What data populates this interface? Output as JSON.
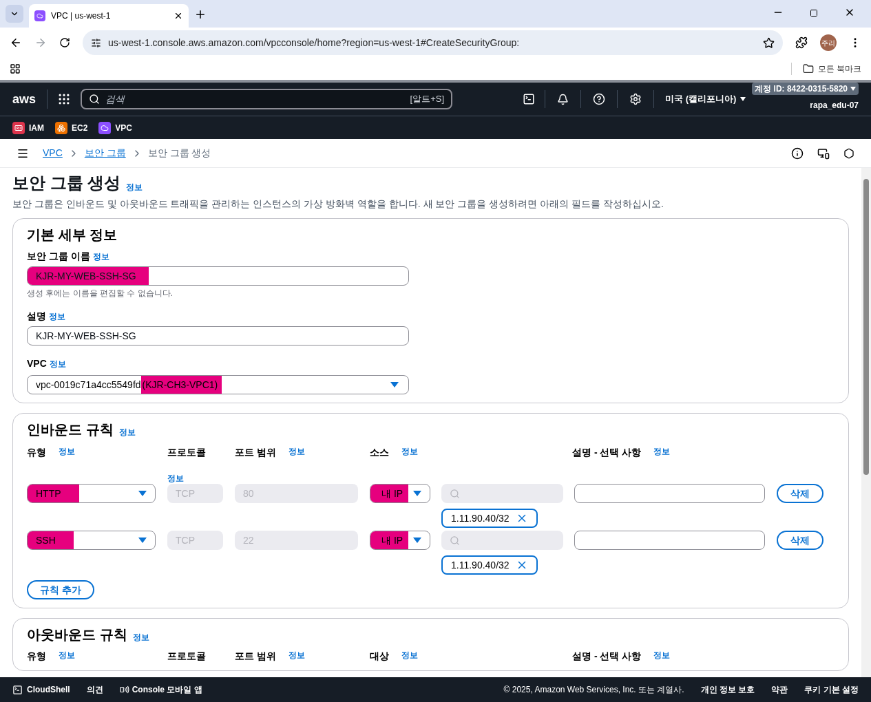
{
  "browser": {
    "tab_title": "VPC | us-west-1",
    "url": "us-west-1.console.aws.amazon.com/vpcconsole/home?region=us-west-1#CreateSecurityGroup:",
    "profile": "주리",
    "bookmarks_label": "모든 북마크"
  },
  "topnav": {
    "logo": "aws",
    "search_placeholder": "검색",
    "shortcut": "[알트+S]",
    "region": "미국 (캘리포니아)",
    "account": "계정 ID: 8422-0315-5820",
    "user": "rapa_edu-07"
  },
  "services": [
    {
      "label": "IAM",
      "color": "#dd344c"
    },
    {
      "label": "EC2",
      "color": "#ed7100"
    },
    {
      "label": "VPC",
      "color": "#8c4fff"
    }
  ],
  "breadcrumbs": [
    {
      "label": "VPC",
      "link": true
    },
    {
      "label": "보안 그룹",
      "link": true
    },
    {
      "label": "보안 그룹 생성",
      "link": false
    }
  ],
  "page": {
    "title": "보안 그룹 생성",
    "info": "정보",
    "description": "보안 그룹은 인바운드 및 아웃바운드 트래픽을 관리하는 인스턴스의 가상 방화벽 역할을 합니다. 새 보안 그룹을 생성하려면 아래의 필드를 작성하십시오."
  },
  "basic": {
    "title": "기본 세부 정보",
    "name": {
      "label": "보안 그룹 이름",
      "info": "정보",
      "value": "KJR-MY-WEB-SSH-SG",
      "highlighted": true,
      "hint": "생성 후에는 이름을 편집할 수 없습니다."
    },
    "description": {
      "label": "설명",
      "info": "정보",
      "value": "KJR-MY-WEB-SSH-SG",
      "highlighted": false
    },
    "vpc": {
      "label": "VPC",
      "info": "정보",
      "value": "vpc-0019c71a4cc5549fd",
      "suffix": "(KJR-CH3-VPC1)",
      "highlighted": true
    }
  },
  "inbound": {
    "title": "인바운드 규칙",
    "info": "정보",
    "columns": [
      {
        "label": "유형",
        "info": "정보"
      },
      {
        "label": "프로토콜",
        "info": "정보"
      },
      {
        "label": "포트 범위",
        "info": "정보"
      },
      {
        "label": "소스",
        "info": "정보"
      },
      {
        "label": "설명 - 선택 사항",
        "info": "정보"
      }
    ],
    "rules": [
      {
        "type": "HTTP",
        "type_highlighted": true,
        "protocol": "TCP",
        "port": "80",
        "source": "내 IP",
        "source_highlighted": true,
        "cidr": "1.11.90.40/32",
        "delete": "삭제"
      },
      {
        "type": "SSH",
        "type_highlighted": true,
        "protocol": "TCP",
        "port": "22",
        "source": "내 IP",
        "source_highlighted": true,
        "cidr": "1.11.90.40/32",
        "delete": "삭제"
      }
    ],
    "add_button": "규칙 추가"
  },
  "outbound": {
    "title": "아웃바운드 규칙",
    "info": "정보",
    "columns": [
      {
        "label": "유형",
        "info": "정보"
      },
      {
        "label": "프로토콜"
      },
      {
        "label": "포트 범위",
        "info": "정보"
      },
      {
        "label": "대상",
        "info": "정보"
      },
      {
        "label": "설명 - 선택 사항",
        "info": "정보"
      }
    ]
  },
  "footer": {
    "cloudshell": "CloudShell",
    "feedback": "의견",
    "mobile": "Console 모바일 앱",
    "copyright": "© 2025, Amazon Web Services, Inc. 또는 계열사.",
    "links": [
      "개인 정보 보호",
      "약관",
      "쿠키 기본 설정"
    ]
  }
}
